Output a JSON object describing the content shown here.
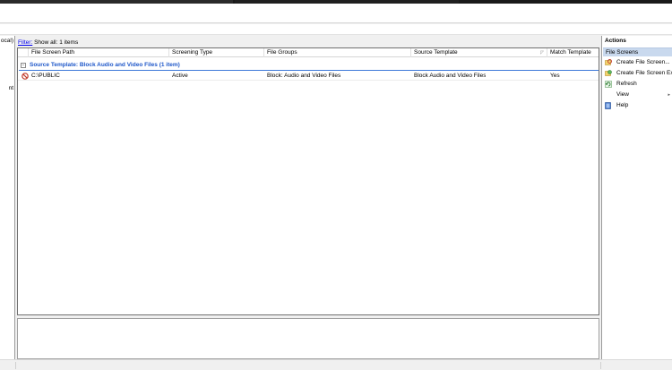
{
  "tree": {
    "nodes": [
      "ocal)",
      "nt"
    ]
  },
  "filter": {
    "link_label": "Filter:",
    "text": "Show all: 1 items"
  },
  "columns": [
    "File Screen Path",
    "Screening Type",
    "File Groups",
    "Source Template",
    "Match Template"
  ],
  "group": {
    "collapse_glyph": "⊟",
    "title": "Source Template: Block Audio and Video Files (1 item)"
  },
  "rows": [
    {
      "path": "C:\\PUBLIC",
      "screening_type": "Active",
      "file_groups": "Block: Audio and Video Files",
      "source_template": "Block Audio and Video Files",
      "match_template": "Yes"
    }
  ],
  "actions": {
    "title": "Actions",
    "section": "File Screens",
    "items": [
      {
        "label": "Create File Screen...",
        "icon": "create-file-screen-icon"
      },
      {
        "label": "Create File Screen Exception...",
        "icon": "create-exception-icon"
      },
      {
        "label": "Refresh",
        "icon": "refresh-icon"
      },
      {
        "label": "View",
        "icon": ""
      },
      {
        "label": "Help",
        "icon": "help-icon"
      }
    ]
  },
  "colors": {
    "group_title": "#1e57c9",
    "section_highlight": "#c9d9ee",
    "link": "#0000ee"
  }
}
